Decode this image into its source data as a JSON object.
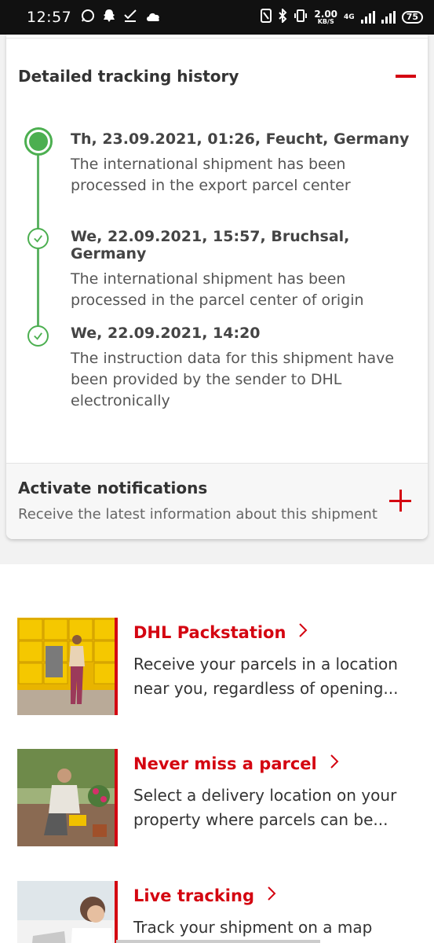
{
  "status_bar": {
    "time": "12:57",
    "left_icons": [
      "whatsapp-icon",
      "snapchat-icon",
      "task-check-icon",
      "cloud-icon"
    ],
    "speed_value": "2.00",
    "speed_unit": "KB/S",
    "network": "4G",
    "battery": "75"
  },
  "tracking": {
    "title": "Detailed tracking history",
    "events": [
      {
        "date": "Th, 23.09.2021, 01:26, Feucht, Germany",
        "text_lines": [
          "The international shipment has been",
          "processed in the export parcel center"
        ]
      },
      {
        "date": "We, 22.09.2021, 15:57, Bruchsal, Germany",
        "text_lines": [
          "The international shipment has been",
          "processed in the parcel center of origin"
        ]
      },
      {
        "date": "We, 22.09.2021, 14:20",
        "text_lines": [
          "The instruction data for this shipment have",
          "been provided by the sender to DHL",
          "electronically"
        ]
      }
    ]
  },
  "notifications": {
    "title": "Activate notifications",
    "subtitle": "Receive the latest information about this shipment"
  },
  "promos": [
    {
      "title": "DHL Packstation",
      "desc_lines": [
        "Receive your parcels in a location",
        "near you, regardless of opening..."
      ]
    },
    {
      "title": "Never miss a parcel",
      "desc_lines": [
        "Select a delivery location on your",
        "property where parcels can be..."
      ]
    },
    {
      "title": "Live tracking",
      "desc_lines": [
        "Track your shipment on a map"
      ]
    }
  ],
  "colors": {
    "brand_red": "#d40511",
    "timeline_green": "#4caf50",
    "dhl_yellow": "#ffcc00"
  }
}
